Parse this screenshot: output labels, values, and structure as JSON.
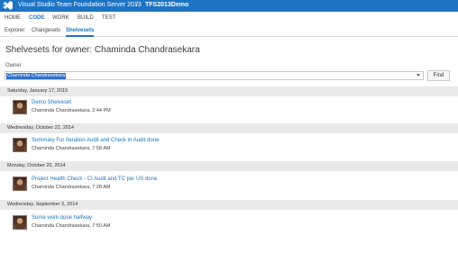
{
  "titlebar": {
    "product": "Visual Studio Team Foundation Server 2013",
    "separator": "/",
    "project": "TFS2013Demo",
    "brand_color": "#1e74c4",
    "logo_icon": "visual-studio-logo-icon"
  },
  "main_nav": {
    "items": [
      "HOME",
      "CODE",
      "WORK",
      "BUILD",
      "TEST"
    ],
    "active": "CODE"
  },
  "sub_nav": {
    "items": [
      "Explorer",
      "Changesets",
      "Shelvesets"
    ],
    "active": "Shelvesets"
  },
  "page_title": "Shelvesets for owner: Chaminda Chandrasekara",
  "owner": {
    "label": "Owner",
    "value": "Chaminda Chandrasekara",
    "dropdown_icon": "chevron-down-icon",
    "find_label": "Find"
  },
  "groups": [
    {
      "date": "Saturday, January 17, 2015",
      "shelvesets": [
        {
          "title": "Demo Shelveset",
          "meta": "Chaminda Chandrasekara, 2:44 PM"
        }
      ]
    },
    {
      "date": "Wednesday, October 22, 2014",
      "shelvesets": [
        {
          "title": "Summary For Iteration Audit and Check in Audit done",
          "meta": "Chaminda Chandrasekara, 7:58 AM"
        }
      ]
    },
    {
      "date": "Monday, October 20, 2014",
      "shelvesets": [
        {
          "title": "Project Health Check - CI Audit and TC per US done",
          "meta": "Chaminda Chandrasekara, 7:28 AM"
        }
      ]
    },
    {
      "date": "Wednesday, September 3, 2014",
      "shelvesets": [
        {
          "title": "Some work done halfway",
          "meta": "Chaminda Chandrasekara, 7:50 AM"
        }
      ]
    }
  ]
}
